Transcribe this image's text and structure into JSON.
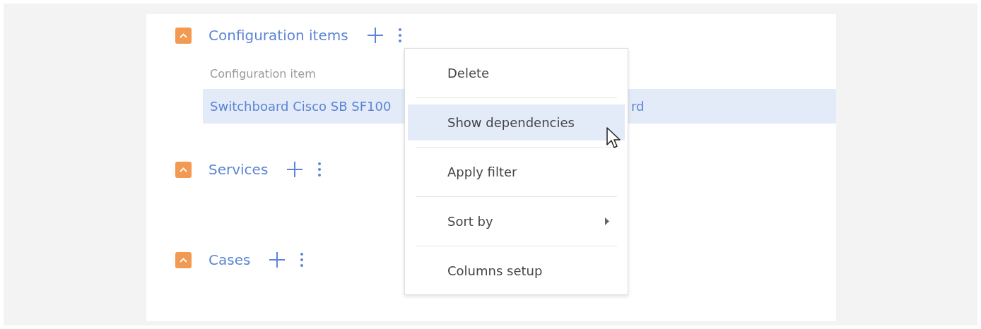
{
  "sections": [
    {
      "title": "Configuration items",
      "expanded": true,
      "table": {
        "columns": [
          "Configuration item"
        ],
        "rows": [
          {
            "selected": true,
            "cells": [
              "Switchboard Cisco SB SF100",
              "rd"
            ]
          }
        ]
      }
    },
    {
      "title": "Services",
      "expanded": true
    },
    {
      "title": "Cases",
      "expanded": true
    }
  ],
  "context_menu": {
    "items": [
      {
        "label": "Delete",
        "selected": false,
        "has_submenu": false
      },
      {
        "label": "Show dependencies",
        "selected": true,
        "has_submenu": false
      },
      {
        "label": "Apply filter",
        "selected": false,
        "has_submenu": false
      },
      {
        "label": "Sort by",
        "selected": false,
        "has_submenu": true
      },
      {
        "label": "Columns setup",
        "selected": false,
        "has_submenu": false
      }
    ]
  }
}
